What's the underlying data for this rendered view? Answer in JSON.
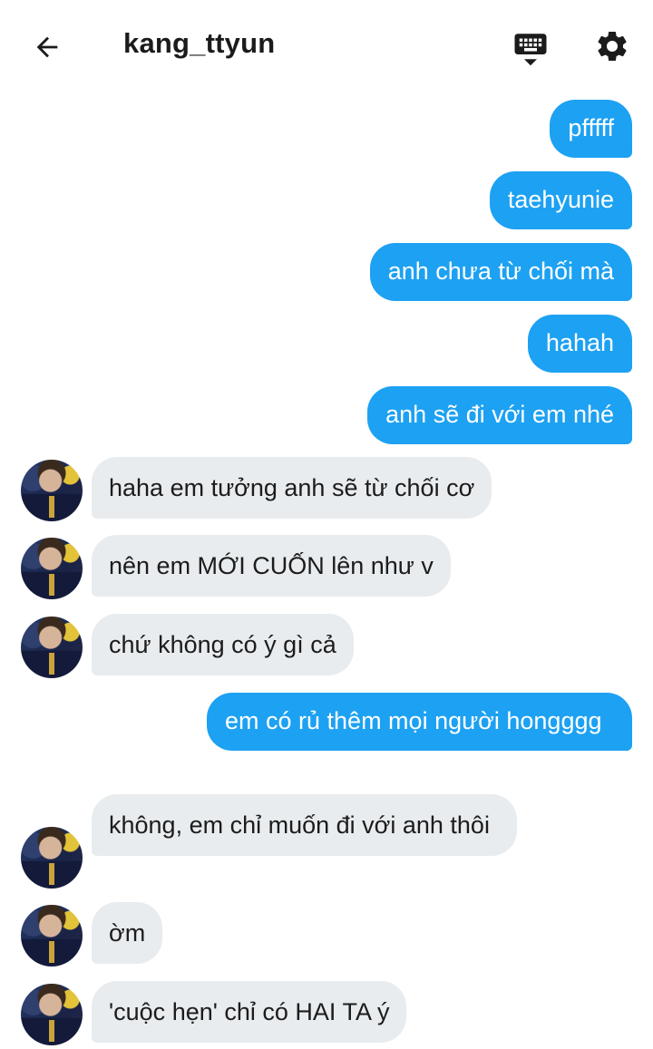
{
  "header": {
    "title": "kang_ttyun",
    "back_icon": "arrow-left-icon",
    "keyboard_icon": "keyboard-icon",
    "settings_icon": "gear-icon"
  },
  "colors": {
    "outgoing_bubble": "#1da1f2",
    "incoming_bubble": "#e8ecef"
  },
  "messages": [
    {
      "direction": "out",
      "text": "pfffff"
    },
    {
      "direction": "out",
      "text": "taehyunie"
    },
    {
      "direction": "out",
      "text": "anh chưa từ chối mà"
    },
    {
      "direction": "out",
      "text": "hahah"
    },
    {
      "direction": "out",
      "text": "anh sẽ đi với em nhé"
    },
    {
      "direction": "in",
      "text": "haha em tưởng anh sẽ từ chối cơ"
    },
    {
      "direction": "in",
      "text": "nên em MỚI CUỐN lên như v"
    },
    {
      "direction": "in",
      "text": "chứ không có ý gì cả"
    },
    {
      "direction": "out",
      "text": "em có rủ thêm mọi người hongggg"
    },
    {
      "direction": "in",
      "text": "không, em chỉ muốn đi với anh thôi"
    },
    {
      "direction": "in",
      "text": "ờm"
    },
    {
      "direction": "in",
      "text": "'cuộc hẹn' chỉ có HAI TA ý"
    }
  ]
}
